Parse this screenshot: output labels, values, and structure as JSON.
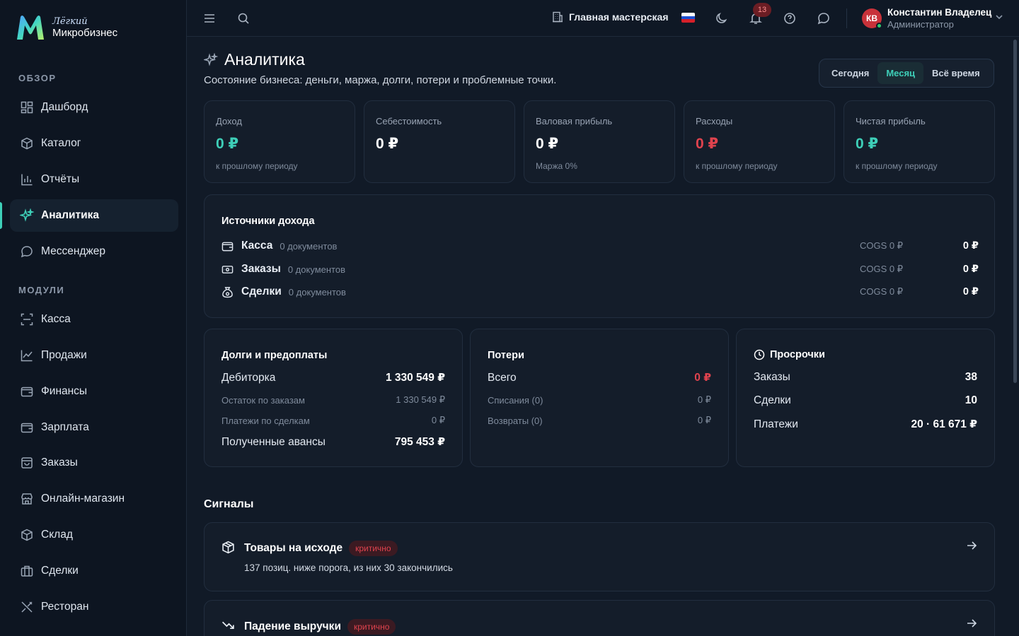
{
  "brand": {
    "line1": "Лёгкий",
    "line2": "Микробизнес"
  },
  "sidebar": {
    "overview_label": "ОБЗОР",
    "modules_label": "МОДУЛИ",
    "overview": [
      {
        "label": "Дашборд",
        "icon": "dashboard-icon"
      },
      {
        "label": "Каталог",
        "icon": "catalog-icon"
      },
      {
        "label": "Отчёты",
        "icon": "reports-icon"
      },
      {
        "label": "Аналитика",
        "icon": "sparkle-icon"
      },
      {
        "label": "Мессенджер",
        "icon": "chat-icon"
      }
    ],
    "modules": [
      {
        "label": "Касса",
        "icon": "scan-icon"
      },
      {
        "label": "Продажи",
        "icon": "chart-line-icon"
      },
      {
        "label": "Финансы",
        "icon": "wallet-icon"
      },
      {
        "label": "Зарплата",
        "icon": "wallet-icon"
      },
      {
        "label": "Заказы",
        "icon": "bag-icon"
      },
      {
        "label": "Онлайн-магазин",
        "icon": "store-icon"
      },
      {
        "label": "Склад",
        "icon": "box-icon"
      },
      {
        "label": "Сделки",
        "icon": "briefcase-icon"
      },
      {
        "label": "Ресторан",
        "icon": "utensils-icon"
      }
    ]
  },
  "topbar": {
    "workshop": "Главная мастерская",
    "notifications_count": "13",
    "user": {
      "initials": "КВ",
      "name": "Константин Владелец",
      "role": "Администратор"
    }
  },
  "page": {
    "title": "Аналитика",
    "subtitle": "Состояние бизнеса: деньги, маржа, долги, потери и проблемные точки."
  },
  "period": {
    "options": [
      "Сегодня",
      "Месяц",
      "Всё время"
    ],
    "selected": "Месяц"
  },
  "kpis": [
    {
      "label": "Доход",
      "value": "0 ₽",
      "note": "к прошлому периоду",
      "color": "#3ecfb8"
    },
    {
      "label": "Себестоимость",
      "value": "0 ₽",
      "note": "",
      "color": "#ffffff"
    },
    {
      "label": "Валовая прибыль",
      "value": "0 ₽",
      "note": "Маржа 0%",
      "color": "#ffffff"
    },
    {
      "label": "Расходы",
      "value": "0 ₽",
      "note": "к прошлому периоду",
      "color": "#e0434e"
    },
    {
      "label": "Чистая прибыль",
      "value": "0 ₽",
      "note": "к прошлому периоду",
      "color": "#3ecfb8"
    }
  ],
  "income_sources": {
    "title": "Источники дохода",
    "rows": [
      {
        "name": "Касса",
        "docs": "0 документов",
        "cogs": "COGS 0 ₽",
        "amount": "0 ₽"
      },
      {
        "name": "Заказы",
        "docs": "0 документов",
        "cogs": "COGS 0 ₽",
        "amount": "0 ₽"
      },
      {
        "name": "Сделки",
        "docs": "0 документов",
        "cogs": "COGS 0 ₽",
        "amount": "0 ₽"
      }
    ]
  },
  "debts": {
    "title": "Долги и предоплаты",
    "receivable_label": "Дебиторка",
    "receivable": "1 330 549 ₽",
    "orders_rest_label": "Остаток по заказам",
    "orders_rest": "1 330 549 ₽",
    "deal_payments_label": "Платежи по сделкам",
    "deal_payments": "0 ₽",
    "advances_label": "Полученные авансы",
    "advances": "795 453 ₽"
  },
  "losses": {
    "title": "Потери",
    "total_label": "Всего",
    "total": "0 ₽",
    "writeoffs_label": "Списания (0)",
    "writeoffs": "0 ₽",
    "returns_label": "Возвраты (0)",
    "returns": "0 ₽",
    "total_color": "#e0434e"
  },
  "overdue": {
    "title": "Просрочки",
    "orders_label": "Заказы",
    "orders": "38",
    "deals_label": "Сделки",
    "deals": "10",
    "payments_label": "Платежи",
    "payments": "20 · 61 671 ₽"
  },
  "signals": {
    "title": "Сигналы",
    "items": [
      {
        "title": "Товары на исходе",
        "badge": "критично",
        "desc": "137 позиц. ниже порога, из них 30 закончились"
      },
      {
        "title": "Падение выручки",
        "badge": "критично",
        "desc": ""
      }
    ]
  }
}
